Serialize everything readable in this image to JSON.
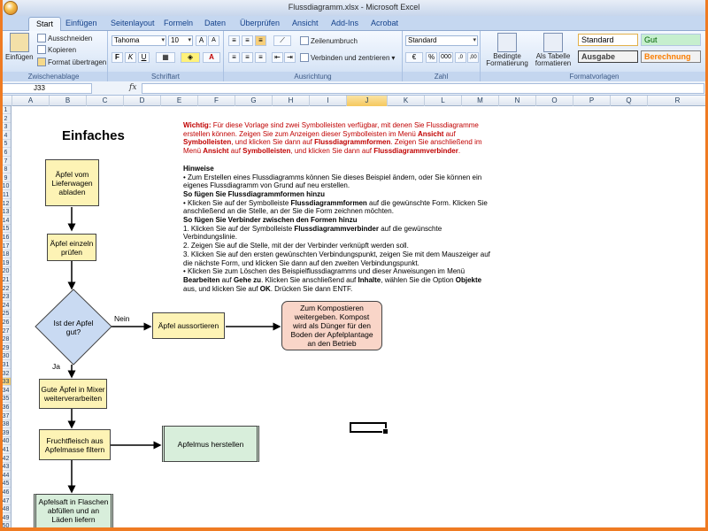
{
  "window": {
    "title": "Flussdiagramm.xlsx - Microsoft Excel"
  },
  "tabs": [
    "Start",
    "Einfügen",
    "Seitenlayout",
    "Formeln",
    "Daten",
    "Überprüfen",
    "Ansicht",
    "Add-Ins",
    "Acrobat"
  ],
  "active_tab": "Start",
  "ribbon": {
    "clipboard": {
      "paste": "Einfügen",
      "cut": "Ausschneiden",
      "copy": "Kopieren",
      "format_painter": "Format übertragen",
      "label": "Zwischenablage"
    },
    "font": {
      "name": "Tahoma",
      "size": "10",
      "bold": "F",
      "italic": "K",
      "underline": "U",
      "label": "Schriftart"
    },
    "alignment": {
      "wrap": "Zeilenumbruch",
      "merge": "Verbinden und zentrieren",
      "label": "Ausrichtung"
    },
    "number": {
      "format": "Standard",
      "label": "Zahl"
    },
    "styles": {
      "conditional": "Bedingte Formatierung",
      "as_table": "Als Tabelle formatieren",
      "standard": "Standard",
      "gut": "Gut",
      "ausgabe": "Ausgabe",
      "berechnung": "Berechnung",
      "label": "Formatvorlagen"
    }
  },
  "formula_bar": {
    "name_box": "J33",
    "fx": "fx",
    "value": ""
  },
  "columns": [
    "A",
    "B",
    "C",
    "D",
    "E",
    "F",
    "G",
    "H",
    "I",
    "J",
    "K",
    "L",
    "M",
    "N",
    "O",
    "P",
    "Q",
    "R"
  ],
  "selected_column": "J",
  "selected_row": "33",
  "rows": [
    "1",
    "2",
    "3",
    "4",
    "5",
    "6",
    "7",
    "8",
    "9",
    "10",
    "11",
    "12",
    "13",
    "14",
    "15",
    "16",
    "17",
    "18",
    "19",
    "20",
    "21",
    "22",
    "23",
    "24",
    "25",
    "26",
    "27",
    "28",
    "29",
    "30",
    "31",
    "32",
    "33",
    "34",
    "35",
    "36",
    "37",
    "38",
    "39",
    "40",
    "41",
    "42",
    "43",
    "44",
    "45",
    "46",
    "47",
    "48",
    "49",
    "50"
  ],
  "sheet": {
    "heading": "Einfaches",
    "instructions": {
      "warning_label": "Wichtig:",
      "warning_1": " Für diese Vorlage sind zwei Symbolleisten verfügbar, mit denen Sie Flussdiagramme erstellen können. Zeigen Sie zum Anzeigen dieser Symbolleisten im Menü ",
      "w_ansicht": "Ansicht",
      "warning_2": " auf ",
      "w_symbolleisten": "Symbolleisten",
      "warning_3": ", und klicken Sie dann auf ",
      "w_formen": "Flussdiagrammformen",
      "warning_4": ". Zeigen Sie anschließend im Menü ",
      "w_ansicht2": "Ansicht",
      "warning_5": " auf ",
      "w_symbolleisten2": "Symbolleisten",
      "warning_6": ", und klicken Sie dann auf ",
      "w_verbinder": "Flussdiagrammverbinder",
      "warning_7": ".",
      "hints_title": "Hinweise",
      "hint_1": "• Zum Erstellen eines Flussdiagramms können Sie dieses Beispiel ändern, oder Sie können ein eigenes Flussdiagramm von Grund auf neu erstellen.",
      "shapes_title": "So fügen Sie Flussdiagrammformen hinzu",
      "shapes_1a": "• Klicken Sie auf der Symbolleiste ",
      "shapes_1b": "Flussdiagrammformen",
      "shapes_1c": " auf die gewünschte Form. Klicken Sie anschließend an die Stelle, an der Sie die Form zeichnen möchten.",
      "conn_title": "So fügen Sie Verbinder zwischen den Formen hinzu",
      "conn_1a": "1. Klicken Sie auf der Symbolleiste ",
      "conn_1b": "Flussdiagrammverbinder",
      "conn_1c": " auf die gewünschte Verbindungslinie.",
      "conn_2": "2. Zeigen Sie auf die Stelle, mit der der Verbinder verknüpft werden soll.",
      "conn_3": "3. Klicken Sie auf den ersten gewünschten Verbindungspunkt, zeigen Sie mit dem Mauszeiger auf die nächste Form, und klicken Sie dann auf den zweiten Verbindungspunkt.",
      "del_1a": "• Klicken Sie zum Löschen des Beispielflussdiagramms und dieser Anweisungen im Menü ",
      "del_1b": "Bearbeiten",
      "del_1c": " auf ",
      "del_1d": "Gehe zu",
      "del_1e": ". Klicken Sie anschließend auf ",
      "del_1f": "Inhalte",
      "del_1g": ", wählen Sie die Option ",
      "del_1h": "Objekte",
      "del_1i": " aus, und klicken Sie auf ",
      "del_1j": "OK",
      "del_1k": ". Drücken Sie dann ENTF."
    },
    "flow": {
      "step1": "Äpfel vom Lieferwagen abladen",
      "step2": "Äpfel einzeln prüfen",
      "decision": "Ist der Apfel gut?",
      "no_label": "Nein",
      "yes_label": "Ja",
      "sort": "Äpfel aussortieren",
      "compost": "Zum Kompostieren weitergeben. Kompost wird als Dünger für den Boden der Apfelplantage an den Betrieb",
      "mixer": "Gute Äpfel in Mixer weiterverarbeiten",
      "fruit": "Fruchtfleisch aus Apfelmasse filtern",
      "applesauce": "Apfelmus herstellen",
      "bottle": "Apfelsaft in Flaschen abfüllen und an Läden liefern"
    }
  },
  "colors": {
    "accent_frame": "#ef7b22",
    "warning_red": "#c00000",
    "yellow_shape": "#fdf3b5",
    "green_shape": "#d8eedb",
    "pink_shape": "#f9d5c8"
  }
}
